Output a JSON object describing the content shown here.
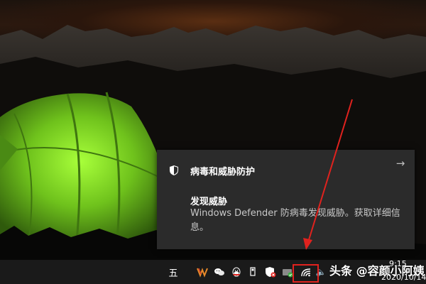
{
  "wallpaper": {
    "scene": "tent at night under mountains"
  },
  "notification": {
    "app_name": "病毒和威胁防护",
    "title": "发现威胁",
    "body": "Windows Defender 防病毒发现威胁。获取详细信息。",
    "arrow_glyph": "→"
  },
  "taskbar": {
    "ime_label": "五",
    "tray_icons": [
      "winamp-icon",
      "wechat-icon",
      "qq-icon",
      "usb-icon",
      "security-alert-icon",
      "defender-check-icon",
      "network-icon",
      "volume-icon"
    ],
    "volume_glyph": "🔈",
    "clock_time": "9:15",
    "clock_date": "2020/10/14"
  },
  "watermark": {
    "text": "头条 @容颜小阿姨"
  },
  "colors": {
    "toast_bg": "#2b2b2b",
    "taskbar_bg": "#1a1a1a",
    "highlight_red": "#e0221e",
    "tent_green": "#7ed321"
  }
}
